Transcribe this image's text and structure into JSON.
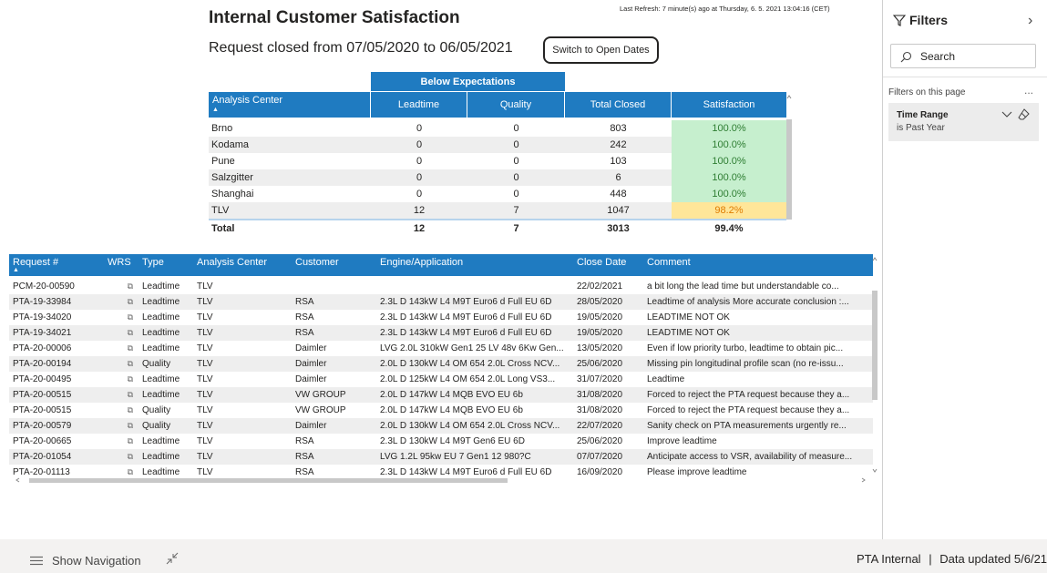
{
  "header": {
    "title": "Internal Customer Satisfaction",
    "refresh": "Last Refresh: 7 minute(s) ago at Thursday, 6. 5. 2021 13:04:16 (CET)",
    "subtitle_prefix": "Request closed from",
    "date_from": "07/05/2020",
    "date_to_word": "to",
    "date_to": "06/05/2021",
    "switch_button": "Switch to Open Dates"
  },
  "summary_table": {
    "banner": "Below Expectations",
    "columns": [
      "Analysis Center",
      "Leadtime",
      "Quality",
      "Total Closed",
      "Satisfaction"
    ],
    "rows": [
      {
        "center": "Brno",
        "leadtime": "0",
        "quality": "0",
        "total": "803",
        "satisfaction": "100.0%"
      },
      {
        "center": "Kodama",
        "leadtime": "0",
        "quality": "0",
        "total": "242",
        "satisfaction": "100.0%"
      },
      {
        "center": "Pune",
        "leadtime": "0",
        "quality": "0",
        "total": "103",
        "satisfaction": "100.0%"
      },
      {
        "center": "Salzgitter",
        "leadtime": "0",
        "quality": "0",
        "total": "6",
        "satisfaction": "100.0%"
      },
      {
        "center": "Shanghai",
        "leadtime": "0",
        "quality": "0",
        "total": "448",
        "satisfaction": "100.0%"
      },
      {
        "center": "TLV",
        "leadtime": "12",
        "quality": "7",
        "total": "1047",
        "satisfaction": "98.2%"
      }
    ],
    "total": {
      "center": "Total",
      "leadtime": "12",
      "quality": "7",
      "total": "3013",
      "satisfaction": "99.4%"
    },
    "colors": {
      "good": "#c6efce",
      "good_text": "#2e7d32",
      "warn": "#ffe699",
      "warn_text": "#e07b00"
    }
  },
  "detail_table": {
    "columns": [
      "Request #",
      "WRS",
      "Type",
      "Analysis Center",
      "Customer",
      "Engine/Application",
      "Close Date",
      "Comment"
    ],
    "rows": [
      [
        "PCM-20-00590",
        "Leadtime",
        "TLV",
        "",
        "",
        "22/02/2021",
        "a bit long the lead time but understandable co..."
      ],
      [
        "PTA-19-33984",
        "Leadtime",
        "TLV",
        "RSA",
        "2.3L D 143kW L4 M9T Euro6 d Full EU 6D",
        "28/05/2020",
        "Leadtime of analysis More accurate conclusion :..."
      ],
      [
        "PTA-19-34020",
        "Leadtime",
        "TLV",
        "RSA",
        "2.3L D 143kW L4 M9T Euro6 d Full EU 6D",
        "19/05/2020",
        "LEADTIME NOT OK"
      ],
      [
        "PTA-19-34021",
        "Leadtime",
        "TLV",
        "RSA",
        "2.3L D 143kW L4 M9T Euro6 d Full EU 6D",
        "19/05/2020",
        "LEADTIME NOT OK"
      ],
      [
        "PTA-20-00006",
        "Leadtime",
        "TLV",
        "Daimler",
        "LVG 2.0L 310kW Gen1 25 LV 48v 6Kw Gen...",
        "13/05/2020",
        "Even if low priority turbo, leadtime to obtain pic..."
      ],
      [
        "PTA-20-00194",
        "Quality",
        "TLV",
        "Daimler",
        "2.0L D 130kW L4 OM 654 2.0L Cross NCV...",
        "25/06/2020",
        "Missing pin longitudinal profile scan (no re-issu..."
      ],
      [
        "PTA-20-00495",
        "Leadtime",
        "TLV",
        "Daimler",
        "2.0L D 125kW L4 OM 654 2.0L Long VS3...",
        "31/07/2020",
        "Leadtime"
      ],
      [
        "PTA-20-00515",
        "Leadtime",
        "TLV",
        "VW GROUP",
        "2.0L D 147kW L4 MQB EVO EU 6b",
        "31/08/2020",
        "Forced to reject the PTA request because they a..."
      ],
      [
        "PTA-20-00515",
        "Quality",
        "TLV",
        "VW GROUP",
        "2.0L D 147kW L4 MQB EVO EU 6b",
        "31/08/2020",
        "Forced to reject the PTA request because they a..."
      ],
      [
        "PTA-20-00579",
        "Quality",
        "TLV",
        "Daimler",
        "2.0L D 130kW L4 OM 654 2.0L Cross NCV...",
        "22/07/2020",
        "Sanity check on PTA measurements urgently re..."
      ],
      [
        "PTA-20-00665",
        "Leadtime",
        "TLV",
        "RSA",
        "2.3L D 130kW L4 M9T Gen6 EU 6D",
        "25/06/2020",
        "Improve leadtime"
      ],
      [
        "PTA-20-01054",
        "Leadtime",
        "TLV",
        "RSA",
        "LVG 1.2L 95kw EU 7 Gen1 12 980?C",
        "07/07/2020",
        "Anticipate access to VSR, availability of measure..."
      ],
      [
        "PTA-20-01113",
        "Leadtime",
        "TLV",
        "RSA",
        "2.3L D 143kW L4 M9T Euro6 d Full EU 6D",
        "16/09/2020",
        "Please improve leadtime"
      ]
    ]
  },
  "filters": {
    "title": "Filters",
    "search_placeholder": "Search",
    "on_page": "Filters on this page",
    "more": "...",
    "card_name": "Time Range",
    "card_value": "is Past Year"
  },
  "footer": {
    "show_nav": "Show Navigation",
    "right_text": "PTA Internal",
    "separator": "|",
    "data_updated": "Data updated 5/6/21"
  },
  "colors": {
    "accent": "#1f7bc1",
    "alt_row": "#eeeeee"
  }
}
